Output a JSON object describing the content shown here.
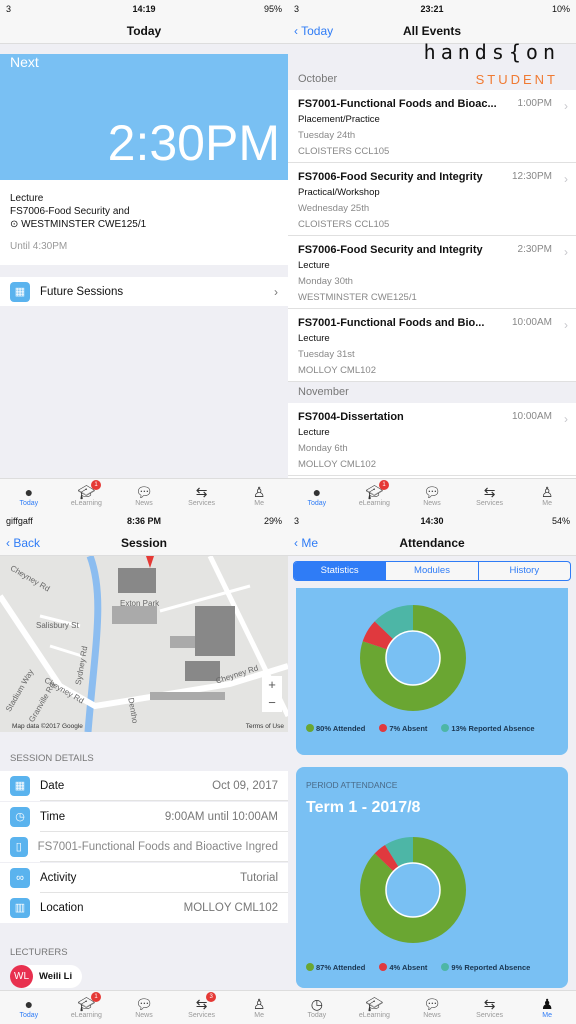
{
  "colors": {
    "accent": "#2f7cf6",
    "card_blue": "#79c0f3",
    "attended": "#6aa632",
    "absent": "#e0393e",
    "reported": "#4db6a6"
  },
  "tabbar": [
    {
      "label": "Today",
      "icon": "clock-icon"
    },
    {
      "label": "eLearning",
      "icon": "graduation-cap-icon"
    },
    {
      "label": "News",
      "icon": "speech-bubble-icon"
    },
    {
      "label": "Services",
      "icon": "signpost-icon"
    },
    {
      "label": "Me",
      "icon": "person-icon"
    }
  ],
  "today": {
    "status": {
      "carrier": "3",
      "time": "14:19",
      "battery": "95%"
    },
    "title": "Today",
    "next_label": "Next",
    "next_time": "2:30PM",
    "type": "Lecture",
    "module": "FS7006-Food Security and",
    "location": "WESTMINSTER CWE125/1",
    "until": "Until 4:30PM",
    "future_sessions": "Future Sessions",
    "elearning_badge": "1"
  },
  "events": {
    "status": {
      "carrier": "3",
      "time": "23:21",
      "battery": "10%"
    },
    "back": "Today",
    "title": "All Events",
    "logo_top": "hands{on",
    "logo_bottom": "STUDENT",
    "sections": [
      {
        "header": "October",
        "items": [
          {
            "title": "FS7001-Functional Foods and Bioac...",
            "time": "1:00PM",
            "type": "Placement/Practice",
            "date": "Tuesday 24th",
            "location": "CLOISTERS CCL105"
          },
          {
            "title": "FS7006-Food Security and Integrity",
            "time": "12:30PM",
            "type": "Practical/Workshop",
            "date": "Wednesday 25th",
            "location": "CLOISTERS CCL105"
          },
          {
            "title": "FS7006-Food Security and Integrity",
            "time": "2:30PM",
            "type": "Lecture",
            "date": "Monday 30th",
            "location": "WESTMINSTER CWE125/1"
          },
          {
            "title": "FS7001-Functional Foods and Bio...",
            "time": "10:00AM",
            "type": "Lecture",
            "date": "Tuesday 31st",
            "location": "MOLLOY CML102"
          }
        ]
      },
      {
        "header": "November",
        "items": [
          {
            "title": "FS7004-Dissertation",
            "time": "10:00AM",
            "type": "Lecture",
            "date": "Monday 6th",
            "location": "MOLLOY CML102"
          }
        ]
      }
    ],
    "elearning_badge": "1"
  },
  "session": {
    "status": {
      "carrier": "giffgaff",
      "time": "8:36 PM",
      "battery": "29%"
    },
    "back": "Back",
    "title": "Session",
    "map": {
      "labels": [
        "Cheyney Rd",
        "Salisbury St",
        "Sydney Rd",
        "Exton Park",
        "Cheyney Rd",
        "Cheyney Rd",
        "Stadium Way",
        "Granville Rd",
        "Dentho"
      ],
      "attribution": "Map data ©2017 Google",
      "terms": "Terms of Use",
      "zoom_in": "+",
      "zoom_out": "−"
    },
    "details_header": "SESSION DETAILS",
    "details": [
      {
        "label": "Date",
        "value": "Oct 09, 2017",
        "icon": "calendar-icon"
      },
      {
        "label": "Time",
        "value": "9:00AM until 10:00AM",
        "icon": "clock-icon"
      },
      {
        "label": "",
        "value": "FS7001-Functional Foods and Bioactive Ingred",
        "icon": "book-icon"
      },
      {
        "label": "Activity",
        "value": "Tutorial",
        "icon": "glasses-icon"
      },
      {
        "label": "Location",
        "value": "MOLLOY CML102",
        "icon": "building-icon"
      }
    ],
    "lecturers_header": "LECTURERS",
    "lecturer": {
      "initials": "WL",
      "name": "Weili Li"
    },
    "elearning_badge": "1",
    "services_badge": "3"
  },
  "attendance": {
    "status": {
      "carrier": "3",
      "time": "14:30",
      "battery": "54%"
    },
    "back": "Me",
    "title": "Attendance",
    "segments": [
      "Statistics",
      "Modules",
      "History"
    ],
    "selected_segment": "Statistics",
    "overall": {
      "attended": 80,
      "absent": 7,
      "reported": 13,
      "legend": [
        "80% Attended",
        "7% Absent",
        "13% Reported Absence"
      ]
    },
    "period": {
      "header": "PERIOD ATTENDANCE",
      "term": "Term 1 - 2017/8",
      "attended": 87,
      "absent": 4,
      "reported": 9,
      "legend": [
        "87% Attended",
        "4% Absent",
        "9% Reported Absence"
      ]
    }
  }
}
